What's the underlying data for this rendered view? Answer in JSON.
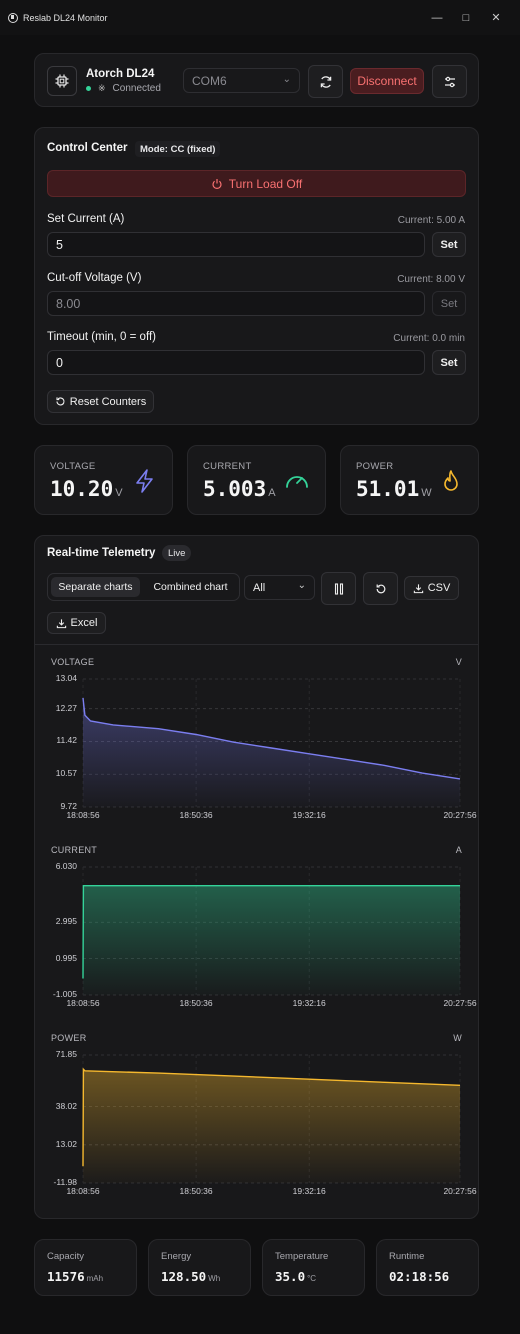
{
  "window": {
    "title": "Reslab DL24 Monitor"
  },
  "device": {
    "name": "Atorch DL24",
    "status": "Connected",
    "port": "COM6",
    "disconnect_label": "Disconnect"
  },
  "control": {
    "title": "Control Center",
    "mode": "Mode: CC (fixed)",
    "load_button": "Turn Load Off",
    "set_current": {
      "label": "Set Current (A)",
      "current": "Current: 5.00 A",
      "value": "5",
      "button": "Set"
    },
    "cutoff": {
      "label": "Cut-off Voltage (V)",
      "current": "Current: 8.00 V",
      "placeholder": "8.00",
      "button": "Set"
    },
    "timeout": {
      "label": "Timeout (min, 0 = off)",
      "current": "Current: 0.0 min",
      "value": "0",
      "button": "Set"
    },
    "reset_label": "Reset Counters"
  },
  "metrics": {
    "voltage": {
      "label": "VOLTAGE",
      "value": "10.20",
      "unit": "V",
      "color": "#7b7ef0"
    },
    "current": {
      "label": "CURRENT",
      "value": "5.003",
      "unit": "A",
      "color": "#34d399"
    },
    "power": {
      "label": "POWER",
      "value": "51.01",
      "unit": "W",
      "color": "#f5b82e"
    }
  },
  "telemetry": {
    "title": "Real-time Telemetry",
    "badge": "Live",
    "tab_separate": "Separate charts",
    "tab_combined": "Combined chart",
    "range": "All",
    "csv": "CSV",
    "excel": "Excel"
  },
  "chart_data": [
    {
      "type": "area",
      "title": "VOLTAGE",
      "unit": "V",
      "color": "#7b7ef0",
      "yticks": [
        "13.04",
        "12.27",
        "11.42",
        "10.57",
        "9.72"
      ],
      "ylim": [
        9.72,
        13.04
      ],
      "xticks": [
        "18:08:56",
        "18:50:36",
        "19:32:16",
        "20:27:56"
      ],
      "x": [
        0,
        0.005,
        0.02,
        0.08,
        0.2,
        0.3,
        0.4,
        0.5,
        0.6,
        0.7,
        0.8,
        0.9,
        1
      ],
      "y": [
        12.55,
        12.1,
        11.95,
        11.85,
        11.75,
        11.6,
        11.4,
        11.25,
        11.1,
        10.95,
        10.8,
        10.6,
        10.45
      ]
    },
    {
      "type": "area",
      "title": "CURRENT",
      "unit": "A",
      "color": "#34d399",
      "yticks": [
        "6.030",
        "2.995",
        "0.995",
        "-1.005"
      ],
      "ylim": [
        -1.005,
        6.03
      ],
      "xticks": [
        "18:08:56",
        "18:50:36",
        "19:32:16",
        "20:27:56"
      ],
      "x": [
        0,
        0.001,
        0.002,
        1
      ],
      "y": [
        -0.1,
        5.0,
        5.0,
        5.0
      ]
    },
    {
      "type": "area",
      "title": "POWER",
      "unit": "W",
      "color": "#f5b82e",
      "yticks": [
        "71.85",
        "38.02",
        "13.02",
        "-11.98"
      ],
      "ylim": [
        -11.98,
        71.85
      ],
      "xticks": [
        "18:08:56",
        "18:50:36",
        "19:32:16",
        "20:27:56"
      ],
      "x": [
        0,
        0.001,
        0.005,
        0.2,
        0.4,
        0.6,
        0.8,
        1
      ],
      "y": [
        -1,
        62.5,
        61.5,
        60.0,
        58.0,
        56.0,
        54.0,
        52.0
      ]
    }
  ],
  "stats": {
    "capacity": {
      "label": "Capacity",
      "value": "11576",
      "unit": "mAh"
    },
    "energy": {
      "label": "Energy",
      "value": "128.50",
      "unit": "Wh"
    },
    "temperature": {
      "label": "Temperature",
      "value": "35.0",
      "unit": "°C"
    },
    "runtime": {
      "label": "Runtime",
      "value": "02:18:56"
    }
  }
}
